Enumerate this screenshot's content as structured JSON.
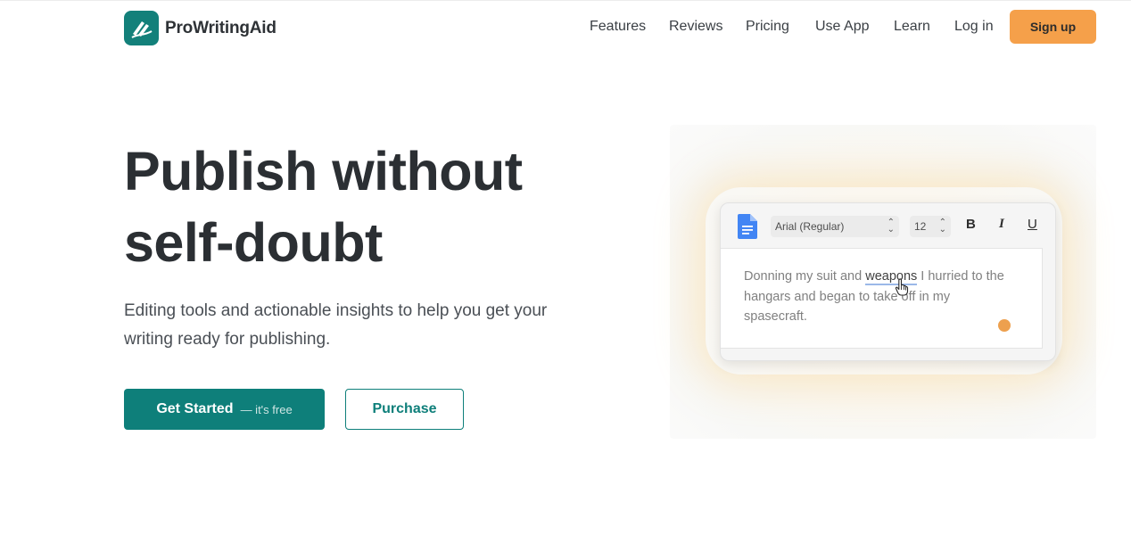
{
  "brand": {
    "name": "ProWritingAid"
  },
  "nav": {
    "items": [
      {
        "label": "Features"
      },
      {
        "label": "Reviews"
      },
      {
        "label": "Pricing"
      },
      {
        "label": "Use App"
      },
      {
        "label": "Learn"
      },
      {
        "label": "Log in"
      }
    ],
    "signup_label": "Sign up"
  },
  "hero": {
    "title_line1": "Publish without",
    "title_line2": "self-doubt",
    "subtitle": "Editing tools and actionable insights to help you get your writing ready for publishing.",
    "primary_button": {
      "label": "Get Started",
      "note": "— it's free"
    },
    "secondary_button": {
      "label": "Purchase"
    }
  },
  "editor": {
    "font_select": "Arial (Regular)",
    "size_select": "12",
    "bold_label": "B",
    "italic_label": "I",
    "underline_label": "U",
    "text_before": "Donning my suit and ",
    "highlighted_word": "weapons",
    "text_after": " I hurried to the hangars and began to take off in my spasecraft."
  },
  "colors": {
    "brand_teal": "#0e7f7a",
    "signup_orange": "#f5a04a",
    "dot_orange": "#eda04e",
    "doc_icon_blue": "#4285f4"
  },
  "icons": {
    "logo": "prowritingaid-logo-icon",
    "doc": "google-docs-icon",
    "cursor": "hand-pointer-icon"
  }
}
